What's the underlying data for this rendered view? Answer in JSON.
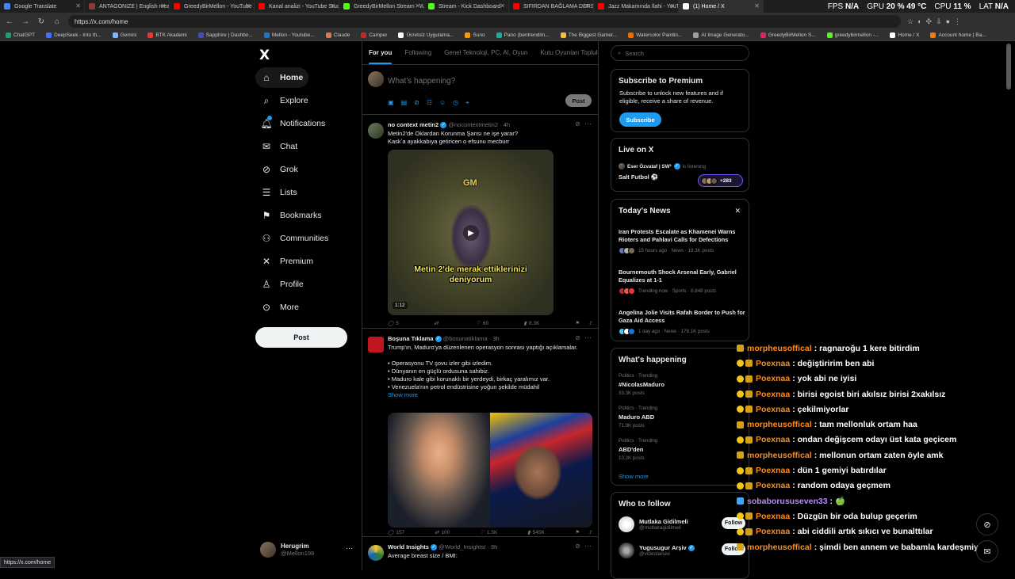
{
  "browser": {
    "tabs": [
      {
        "title": "Google Translate",
        "color": "#4285f4",
        "active": false
      },
      {
        "title": "ANTAGONIZE | English meaning -",
        "color": "#8b3a3a",
        "active": false
      },
      {
        "title": "GreedyBirMellon - YouTube",
        "color": "#ff0000",
        "active": false
      },
      {
        "title": "Kanal analizi - YouTube Studio",
        "color": "#ff0000",
        "active": false
      },
      {
        "title": "GreedyBirMellon Stream - Watch",
        "color": "#53fc18",
        "active": false
      },
      {
        "title": "Stream - Kick Dashboard",
        "color": "#53fc18",
        "active": false
      },
      {
        "title": "SIFIRDAN BAĞLAMA DERSİ 7 ( BU",
        "color": "#ff0000",
        "active": false
      },
      {
        "title": "Jazz Makamında İlahi - YouTube",
        "color": "#ff0000",
        "active": false
      },
      {
        "title": "(1) Home / X",
        "color": "#ffffff",
        "active": true
      }
    ],
    "url": "https://x.com/home",
    "status_url": "https://x.com/home",
    "bookmarks": [
      {
        "label": "ChatGPT",
        "color": "#10a37f"
      },
      {
        "label": "DeepSeek - Into th...",
        "color": "#4d6bfe"
      },
      {
        "label": "Gemini",
        "color": "#8ab4f8"
      },
      {
        "label": "BTK Akademi",
        "color": "#e53935"
      },
      {
        "label": "Sapphire | Dashbo...",
        "color": "#3f51b5"
      },
      {
        "label": "Mellon - Youtube...",
        "color": "#1976d2"
      },
      {
        "label": "Claude",
        "color": "#d97757"
      },
      {
        "label": "Camper",
        "color": "#c62828"
      },
      {
        "label": "Ücretsiz Uygulama...",
        "color": "#ffffff"
      },
      {
        "label": "Suno",
        "color": "#ff9800"
      },
      {
        "label": "Pano (bentrendim...",
        "color": "#26a69a"
      },
      {
        "label": "The Biggest Gamer...",
        "color": "#fbc02d"
      },
      {
        "label": "Watercolor Paintin...",
        "color": "#ef6c00"
      },
      {
        "label": "AI Image Generato...",
        "color": "#9e9e9e"
      },
      {
        "label": "GreedyBirMellon S...",
        "color": "#e91e63"
      },
      {
        "label": "greedybirmellon -...",
        "color": "#53fc18"
      },
      {
        "label": "Home / X",
        "color": "#ffffff"
      },
      {
        "label": "Account home | Ba...",
        "color": "#f57c00"
      }
    ]
  },
  "overlay_stats": {
    "fps_label": "FPS",
    "fps_value": "N/A",
    "gpu_label": "GPU",
    "gpu_value": "20 %",
    "gpu_temp": "49 °C",
    "cpu_label": "CPU",
    "cpu_value": "11 %",
    "lat_label": "LAT",
    "lat_value": "N/A"
  },
  "nav": {
    "logo": "X",
    "items": [
      {
        "label": "Home",
        "icon": "home-icon",
        "glyph": "⌂"
      },
      {
        "label": "Explore",
        "icon": "search-icon",
        "glyph": "⌕"
      },
      {
        "label": "Notifications",
        "icon": "bell-icon",
        "glyph": "🔔︎"
      },
      {
        "label": "Chat",
        "icon": "mail-icon",
        "glyph": "✉"
      },
      {
        "label": "Grok",
        "icon": "grok-icon",
        "glyph": "⊘"
      },
      {
        "label": "Lists",
        "icon": "list-icon",
        "glyph": "☰"
      },
      {
        "label": "Bookmarks",
        "icon": "bookmark-icon",
        "glyph": "⚑"
      },
      {
        "label": "Communities",
        "icon": "people-icon",
        "glyph": "⚇"
      },
      {
        "label": "Premium",
        "icon": "x-premium-icon",
        "glyph": "✕"
      },
      {
        "label": "Profile",
        "icon": "person-icon",
        "glyph": "♙"
      },
      {
        "label": "More",
        "icon": "more-circle-icon",
        "glyph": "⊙"
      }
    ],
    "post_label": "Post",
    "account_name": "Herugrim",
    "account_handle": "@Mellon199"
  },
  "feed": {
    "tabs": [
      "For you",
      "Following",
      "Genel Teknoloji, PC, AI, Oyun",
      "Kutu Oyunları Topluluğu"
    ],
    "compose_placeholder": "What's happening?",
    "compose_post": "Post",
    "tweets": [
      {
        "name": "no context metin2",
        "handle": "@nocontextmetin2 · 4h",
        "text_lines": [
          "Metin2'de Oklardan Korunma Şansı ne işe yarar?",
          "Kaskʼa ayakkabıya getiricen o efsunu mecburr"
        ],
        "media_caption": "Metin 2'de merak ettiklerinizi deniyorum",
        "media_tag": "GM",
        "duration": "1:12",
        "replies": "5",
        "reposts": "",
        "likes": "60",
        "views": "8.3K"
      },
      {
        "name": "Boşuna Tıklama",
        "handle": "@bosunatiklama · 3h",
        "text_lines": [
          "Trump'ın, Maduro'ya düzenlenen operasyon sonrası yaptığı açıklamalar.",
          "",
          "• Operasyonu TV şovu izler gibi izledim.",
          "• Dünyanın en güçlü ordusuna sahibiz.",
          "• Maduro kale gibi korunaklı bir yerdeydi, birkaç yaralımız var.",
          "• Venezuela'nın petrol endüstrisine yoğun şekilde müdahil"
        ],
        "show_more": "Show more",
        "replies": "157",
        "reposts": "100",
        "likes": "1.5K",
        "views": "545K"
      },
      {
        "name": "World Insights",
        "handle": "@World_Insightst · 9h",
        "text_lines": [
          "Average breast size / BMI:"
        ]
      }
    ]
  },
  "right": {
    "search_placeholder": "Search",
    "premium": {
      "title": "Subscribe to Premium",
      "body": "Subscribe to unlock new features and if eligible, receive a share of revenue.",
      "button": "Subscribe"
    },
    "live": {
      "title": "Live on X",
      "host": "Eser Özvataf | SW³",
      "status": "is listening",
      "space_title": "Salt Futbol ⚽",
      "listeners": "+283"
    },
    "news": {
      "title": "Today's News",
      "items": [
        {
          "title": "Iran Protests Escalate as Khamenei Warns Rioters and Pahlavi Calls for Defections",
          "meta": "15 hours ago · News · 19.3K posts"
        },
        {
          "title": "Bournemouth Shock Arsenal Early, Gabriel Equalizes at 1-1",
          "meta": "Trending now · Sports · 8,848 posts"
        },
        {
          "title": "Angelina Jolie Visits Rafah Border to Push for Gaza Aid Access",
          "meta": "1 day ago · News · 178.1K posts"
        }
      ]
    },
    "happening": {
      "title": "What's happening",
      "trends": [
        {
          "cat": "Politics · Trending",
          "tag": "#NicolasMaduro",
          "count": "33.3K posts"
        },
        {
          "cat": "Politics · Trending",
          "tag": "Maduro ABD",
          "count": "71.9K posts"
        },
        {
          "cat": "Politics · Trending",
          "tag": "ABD'den",
          "count": "10.2K posts"
        }
      ],
      "show_more": "Show more"
    },
    "who_to_follow": {
      "title": "Who to follow",
      "users": [
        {
          "name": "Mutlaka Gidilmeli",
          "handle": "@mutlakagidilmeli",
          "button": "Follow"
        },
        {
          "name": "Yugusugur Arşiv",
          "handle": "@videolarsivi",
          "button": "Follow"
        }
      ]
    }
  },
  "chat": [
    {
      "user": "morpheusoffical",
      "color": "#ff8c1a",
      "text": "ragnaroğu 1 kere bitirdim"
    },
    {
      "user": "Poexnaa",
      "color": "#ff8c1a",
      "text": "değiştiririm ben abi"
    },
    {
      "user": "Poexnaa",
      "color": "#ff8c1a",
      "text": "yok abi ne iyisi"
    },
    {
      "user": "Poexnaa",
      "color": "#ff8c1a",
      "text": "birisi egoist biri akılsız birisi 2xakılsız"
    },
    {
      "user": "Poexnaa",
      "color": "#ff8c1a",
      "text": "çekilmiyorlar"
    },
    {
      "user": "morpheusoffical",
      "color": "#ff8c1a",
      "text": "tam mellonluk ortam haa"
    },
    {
      "user": "Poexnaa",
      "color": "#ff8c1a",
      "text": "ondan değişcem odayı üst kata geçicem"
    },
    {
      "user": "morpheusoffical",
      "color": "#ff8c1a",
      "text": "mellonun ortam zaten öyle amk"
    },
    {
      "user": "Poexnaa",
      "color": "#ff8c1a",
      "text": "dün 1 gemiyi batırdılar"
    },
    {
      "user": "Poexnaa",
      "color": "#ff8c1a",
      "text": "random odaya geçmem"
    },
    {
      "user": "sobaborususeven33",
      "color": "#b48cff",
      "text": "🍏"
    },
    {
      "user": "Poexnaa",
      "color": "#ff8c1a",
      "text": "Düzgün bir oda bulup geçerim"
    },
    {
      "user": "Poexnaa",
      "color": "#ff8c1a",
      "text": "abi ciddili artık sıkıcı ve bunalttılar"
    },
    {
      "user": "morpheusoffical",
      "color": "#ff8c1a",
      "text": "şimdi ben annem ve babamla kardeşmiyim"
    }
  ],
  "colors": {
    "accent": "#1d9bf0",
    "background": "#000000",
    "border": "#2f3336",
    "muted": "#71767b"
  }
}
